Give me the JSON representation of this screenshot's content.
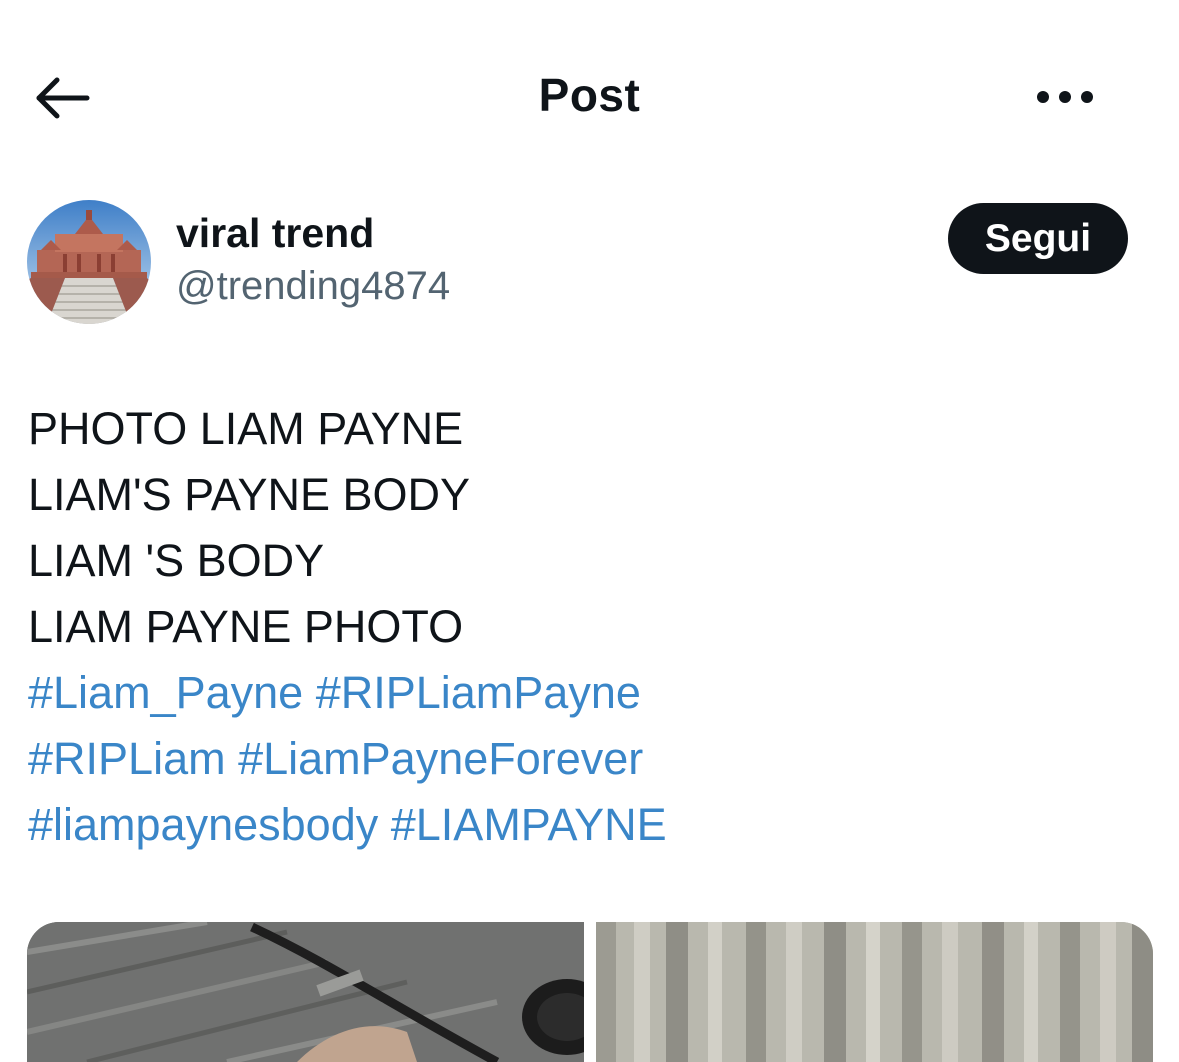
{
  "header": {
    "title": "Post",
    "back_icon": "arrow-left-icon",
    "more_icon": "more-horizontal-icon"
  },
  "author": {
    "name": "viral trend",
    "handle": "@trending4874",
    "follow_label": "Segui"
  },
  "post": {
    "lines": [
      "PHOTO LIAM PAYNE",
      "LIAM'S PAYNE BODY",
      "LIAM 'S BODY",
      "LIAM PAYNE PHOTO"
    ],
    "hashtag_lines": [
      [
        "#Liam_Payne",
        "#RIPLiamPayne"
      ],
      [
        "#RIPLiam",
        "#LiamPayneForever"
      ],
      [
        "#liampaynesbody",
        "#LIAMPAYNE"
      ]
    ]
  },
  "colors": {
    "text": "#0f1419",
    "secondary": "#536471",
    "link": "#3a86c8",
    "button_bg": "#0f1419"
  }
}
